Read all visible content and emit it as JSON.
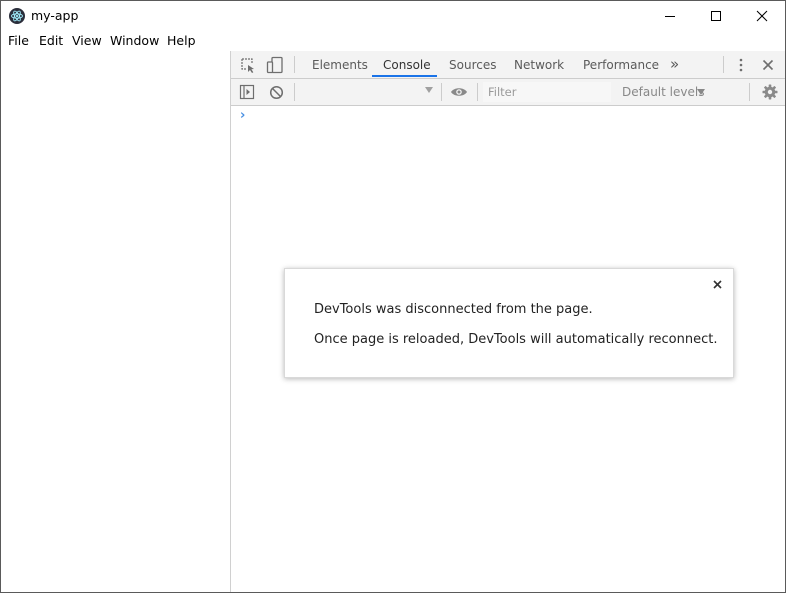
{
  "window": {
    "title": "my-app"
  },
  "menu": {
    "items": [
      "File",
      "Edit",
      "View",
      "Window",
      "Help"
    ]
  },
  "devtools": {
    "tabs": [
      {
        "label": "Elements",
        "active": false
      },
      {
        "label": "Console",
        "active": true
      },
      {
        "label": "Sources",
        "active": false
      },
      {
        "label": "Network",
        "active": false
      },
      {
        "label": "Performance",
        "active": false
      }
    ],
    "more_tabs_glyph": "»",
    "filter": {
      "placeholder": "Filter",
      "value": ""
    },
    "levels_label": "Default levels",
    "prompt_glyph": "›",
    "accent_color": "#1a73e8"
  },
  "dialog": {
    "line1": "DevTools was disconnected from the page.",
    "line2": "Once page is reloaded, DevTools will automatically reconnect."
  },
  "icons": {
    "app": "electron-atom-icon",
    "minimize": "minimize-icon",
    "maximize": "maximize-icon",
    "close": "close-icon",
    "inspect": "inspect-element-icon",
    "device": "device-toolbar-icon",
    "sidebar": "console-sidebar-icon",
    "clear": "clear-console-icon",
    "eye": "live-expression-eye-icon",
    "kebab": "kebab-menu-icon",
    "devtools_close": "close-devtools-icon",
    "settings": "gear-icon",
    "dialog_close": "close-dialog-icon"
  }
}
